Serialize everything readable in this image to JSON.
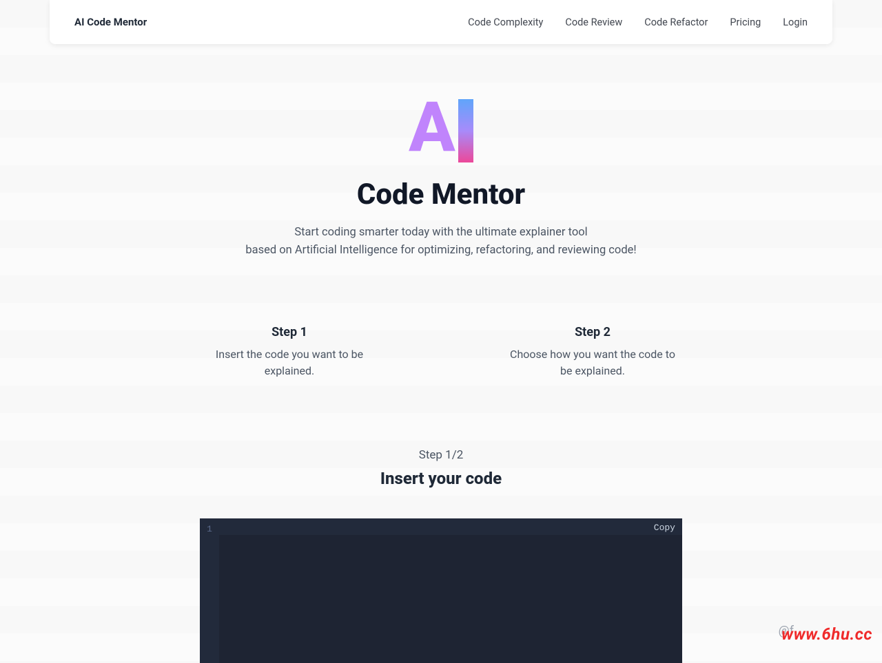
{
  "header": {
    "brand": "AI Code Mentor",
    "nav": {
      "complexity": "Code Complexity",
      "review": "Code Review",
      "refactor": "Code Refactor",
      "pricing": "Pricing",
      "login": "Login"
    }
  },
  "hero": {
    "logo_letters": "AI",
    "title": "Code Mentor",
    "subtitle_line1": "Start coding smarter today with the ultimate explainer tool",
    "subtitle_line2": "based on Artificial Intelligence for optimizing, refactoring, and reviewing code!"
  },
  "steps": {
    "step1": {
      "title": "Step 1",
      "desc": "Insert the code you want to be explained."
    },
    "step2": {
      "title": "Step 2",
      "desc": "Choose how you want the code to be explained."
    }
  },
  "current": {
    "label": "Step 1/2",
    "title": "Insert your code"
  },
  "editor": {
    "line_number": "1",
    "copy_label": "Copy",
    "value": ""
  },
  "footer": {
    "handle_fragment": "@f",
    "watermark": "www.6hu.cc"
  }
}
